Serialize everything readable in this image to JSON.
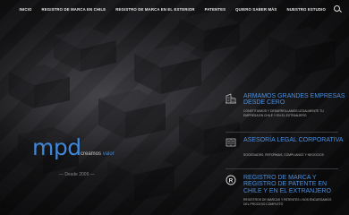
{
  "nav": {
    "items": [
      "INICIO",
      "REGISTRO DE MARCA EN CHILE",
      "REGISTRO DE MARCA EN EL EXTERIOR",
      "PATENTES",
      "QUIERO SABER MÁS",
      "NUESTRO ESTUDIO"
    ],
    "search_icon": "search-icon"
  },
  "logo": {
    "mark": "mpd",
    "tag_plain": "creamos ",
    "tag_accent": "valor",
    "since": "— Desde 2009 —"
  },
  "features": [
    {
      "icon": "building-icon",
      "title": "ARMAMOS GRANDES EMPRESAS DESDE CERO",
      "text": "CONSTITUIMOS Y DESARROLLAMOS LEGALMENTE TU EMPRESA EN CHILE Y EN EL EXTRANJERO"
    },
    {
      "icon": "book-icon",
      "title": "ASESORÍA LEGAL CORPORATIVA",
      "text": "SOCIEDADES, REFORMAS, COMPLIANCE Y NEGOCIOS"
    },
    {
      "icon": "registered-icon",
      "title": "REGISTRO DE MARCA Y REGISTRO DE PATENTE EN CHILE Y EN EL EXTRANJERO",
      "text": "REGISTROS DE MARCAS Y PATENTES • NOS ENCARGAMOS DEL PROCESO COMPLETO"
    }
  ],
  "colors": {
    "accent": "#3f86d6",
    "background": "#0b0b0c"
  }
}
